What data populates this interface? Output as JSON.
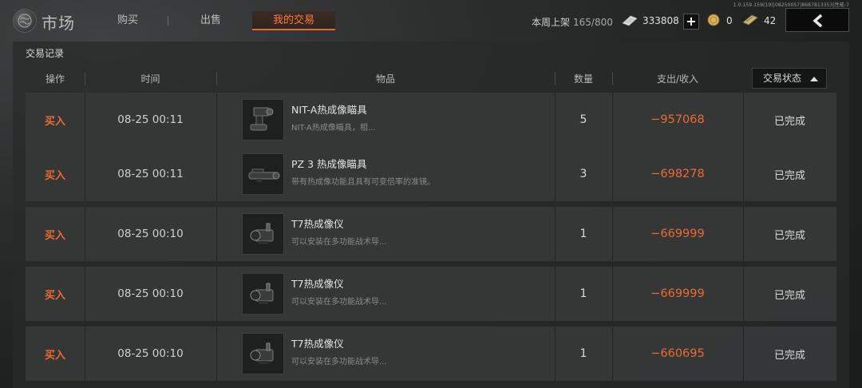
{
  "version": "1.0.159.159(19)|08250057|8687813353|性能-7",
  "header": {
    "title": "市场",
    "tabs": [
      {
        "label": "购买"
      },
      {
        "label": "出售"
      },
      {
        "label": "我的交易",
        "active": true
      }
    ],
    "weekly_label": "本周上架",
    "weekly_value": "165/800",
    "currencies": {
      "silver": {
        "icon": "silver-bar-icon",
        "value": "333808"
      },
      "gold": {
        "icon": "gold-coin-icon",
        "value": "0"
      },
      "note": {
        "icon": "banknote-icon",
        "value": "42"
      }
    },
    "plus_label": "+",
    "back_icon": "chevron-left-icon"
  },
  "panel": {
    "section_title": "交易记录",
    "columns": [
      "操作",
      "时间",
      "物品",
      "数量",
      "支出/收入",
      "交易状态"
    ],
    "sort_direction": "ascending",
    "rows": [
      {
        "action": "买入",
        "time": "08-25 00:11",
        "item_name": "NIT-A热成像瞄具",
        "item_desc": "NIT-A热成像瞄具，相...",
        "item_icon": "thermal-scope-icon",
        "qty": "5",
        "amount": "−957068",
        "status": "已完成"
      },
      {
        "action": "买入",
        "time": "08-25 00:11",
        "item_name": "PZ 3 热成像瞄具",
        "item_desc": "带有热成像功能且具有可变倍率的准镜。",
        "item_icon": "rifle-scope-icon",
        "qty": "3",
        "amount": "−698278",
        "status": "已完成"
      },
      {
        "action": "买入",
        "time": "08-25 00:10",
        "item_name": "T7热成像仪",
        "item_desc": "可以安装在多功能战术导...",
        "item_icon": "thermal-imager-icon",
        "qty": "1",
        "amount": "−669999",
        "status": "已完成"
      },
      {
        "action": "买入",
        "time": "08-25 00:10",
        "item_name": "T7热成像仪",
        "item_desc": "可以安装在多功能战术导...",
        "item_icon": "thermal-imager-icon",
        "qty": "1",
        "amount": "−669999",
        "status": "已完成"
      },
      {
        "action": "买入",
        "time": "08-25 00:10",
        "item_name": "T7热成像仪",
        "item_desc": "可以安装在多功能战术导...",
        "item_icon": "thermal-imager-icon",
        "qty": "1",
        "amount": "−660695",
        "status": "已完成"
      }
    ]
  },
  "colors": {
    "accent": "#ec6a31",
    "background": "#2b2d2d",
    "row_bg": "#363838"
  }
}
